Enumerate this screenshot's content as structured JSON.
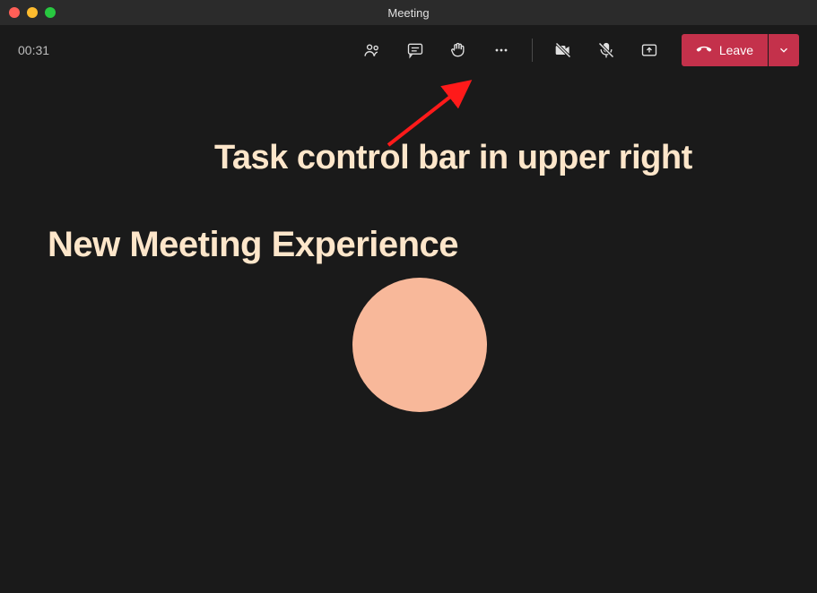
{
  "window": {
    "title": "Meeting"
  },
  "toolbar": {
    "timer": "00:31",
    "leave_label": "Leave"
  },
  "annotations": {
    "line1": "Task control bar in upper right",
    "line2": "New Meeting Experience"
  },
  "colors": {
    "avatar_bg": "#f8b89a",
    "annotation_text": "#fde6ca",
    "leave_bg": "#c4314b",
    "arrow": "#ff1a1a"
  },
  "icons": {
    "people": "people-icon",
    "chat": "chat-icon",
    "raise_hand": "raise-hand-icon",
    "more": "more-icon",
    "camera_off": "camera-off-icon",
    "mic_off": "mic-off-icon",
    "share": "share-screen-icon",
    "hangup": "hangup-icon",
    "chevron": "chevron-down-icon"
  }
}
